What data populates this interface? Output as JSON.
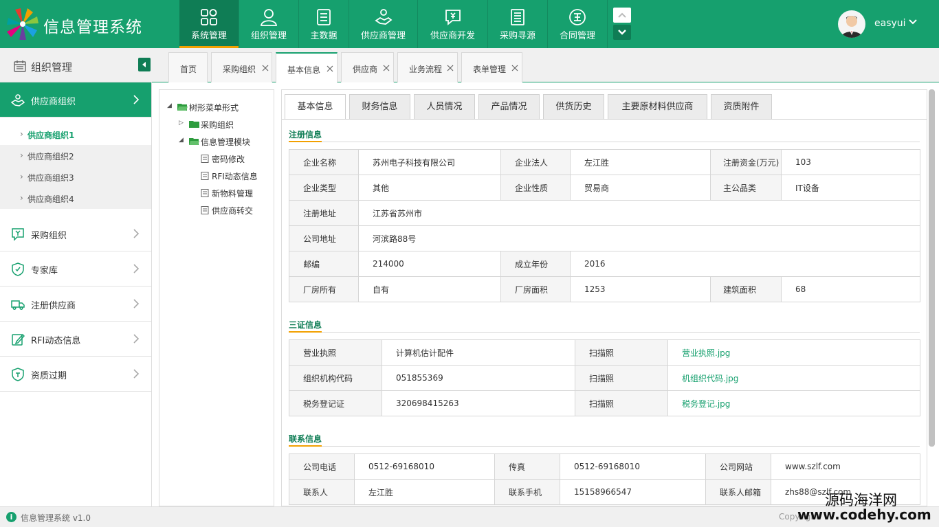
{
  "app": {
    "title": "信息管理系统"
  },
  "topnav": [
    {
      "label": "系统管理",
      "icon": "grid-icon",
      "active": true
    },
    {
      "label": "组织管理",
      "icon": "user-icon"
    },
    {
      "label": "主数据",
      "icon": "document-icon"
    },
    {
      "label": "供应商管理",
      "icon": "handshake-icon"
    },
    {
      "label": "供应商开发",
      "icon": "money-chat-icon"
    },
    {
      "label": "采购寻源",
      "icon": "list-icon"
    },
    {
      "label": "合同管理",
      "icon": "quality-icon"
    }
  ],
  "user": {
    "name": "easyui"
  },
  "sidebar": {
    "title": "组织管理",
    "menus": [
      {
        "label": "供应商组织",
        "icon": "suppliers-icon",
        "active": true
      },
      {
        "label": "采购组织",
        "icon": "purchase-icon"
      },
      {
        "label": "专家库",
        "icon": "expert-icon"
      },
      {
        "label": "注册供应商",
        "icon": "truck-icon"
      },
      {
        "label": "RFI动态信息",
        "icon": "edit-icon"
      },
      {
        "label": "资质过期",
        "icon": "shield-icon"
      }
    ],
    "submenu": [
      "供应商组织1",
      "供应商组织2",
      "供应商组织3",
      "供应商组织4"
    ]
  },
  "pagetabs": [
    {
      "label": "首页"
    },
    {
      "label": "采购组织"
    },
    {
      "label": "基本信息",
      "active": true
    },
    {
      "label": "供应商"
    },
    {
      "label": "业务流程"
    },
    {
      "label": "表单管理"
    }
  ],
  "tree": {
    "root": "树形菜单形式",
    "folder1": "采购组织",
    "folder2": "信息管理模块",
    "leaves": [
      "密码修改",
      "RFI动态信息",
      "新物料管理",
      "供应商转交"
    ]
  },
  "innertabs": [
    "基本信息",
    "财务信息",
    "人员情况",
    "产品情况",
    "供货历史",
    "主要原材料供应商",
    "资质附件"
  ],
  "sections": {
    "reg": "注册信息",
    "cert": "三证信息",
    "contact": "联系信息"
  },
  "reg": {
    "k_name": "企业名称",
    "v_name": "苏州电子科技有限公司",
    "k_legal": "企业法人",
    "v_legal": "左江胜",
    "k_capital": "注册资金(万元)",
    "v_capital": "103",
    "k_type": "企业类型",
    "v_type": "其他",
    "k_nature": "企业性质",
    "v_nature": "贸易商",
    "k_cat": "主公品类",
    "v_cat": "IT设备",
    "k_regaddr": "注册地址",
    "v_regaddr": "江苏省苏州市",
    "k_addr": "公司地址",
    "v_addr": "河滨路88号",
    "k_zip": "邮编",
    "v_zip": "214000",
    "k_year": "成立年份",
    "v_year": "2016",
    "k_own": "厂房所有",
    "v_own": "自有",
    "k_area": "厂房面积",
    "v_area": "1253",
    "k_build": "建筑面积",
    "v_build": "68"
  },
  "cert": {
    "k_license": "营业执照",
    "v_license": "计算机估计配件",
    "k_scan1": "扫描照",
    "f_scan1": "营业执照.jpg",
    "k_org": "组织机构代码",
    "v_org": "051855369",
    "k_scan2": "扫描照",
    "f_scan2": "机组织代码.jpg",
    "k_tax": "税务登记证",
    "v_tax": "320698415263",
    "k_scan3": "扫描照",
    "f_scan3": "税务登记.jpg"
  },
  "contact": {
    "k_tel": "公司电话",
    "v_tel": "0512-69168010",
    "k_fax": "传真",
    "v_fax": "0512-69168010",
    "k_web": "公司网站",
    "v_web": "www.szlf.com",
    "k_person": "联系人",
    "v_person": "左江胜",
    "k_mobile": "联系手机",
    "v_mobile": "15158966547",
    "k_email": "联系人邮箱",
    "v_email": "zhs88@szlf.com"
  },
  "status": {
    "version": "信息管理系统 v1.0",
    "copyright": "Copyright"
  },
  "watermark": {
    "line1": "源码海洋网",
    "line2": "www.codehy.com"
  },
  "colors": {
    "primary": "#16a06e",
    "dark": "#0f7d55",
    "accent": "#f2a000"
  }
}
